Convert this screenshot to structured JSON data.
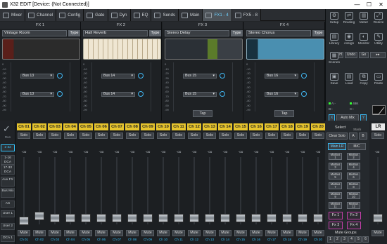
{
  "window": {
    "title": "X32 EDIT [Device: (Not Connected)]",
    "controls": [
      "—",
      "☐",
      "✕"
    ]
  },
  "nav": [
    {
      "label": "Mixer",
      "icon": "sliders-icon"
    },
    {
      "label": "Channel",
      "icon": "channel-icon"
    },
    {
      "label": "Config",
      "icon": "config-icon"
    },
    {
      "label": "Gate",
      "icon": "gate-icon"
    },
    {
      "label": "Dyn",
      "icon": "dyn-icon"
    },
    {
      "label": "EQ",
      "icon": "eq-icon"
    },
    {
      "label": "Sends",
      "icon": "sends-icon"
    },
    {
      "label": "Main",
      "icon": "main-icon"
    },
    {
      "label": "FX1 - 4",
      "icon": "fx-wave-icon",
      "active": true
    },
    {
      "label": "FX5 - 8",
      "icon": "fx-icon"
    }
  ],
  "fx": [
    {
      "header": "FX 1",
      "preset": "Vintage Room",
      "type": "Type",
      "buses": [
        "Bus 13",
        "Bus 13"
      ],
      "tap": ""
    },
    {
      "header": "FX 2",
      "preset": "Hall Reverb",
      "type": "Type",
      "buses": [
        "Bus 14",
        "Bus 14"
      ],
      "tap": ""
    },
    {
      "header": "FX 3",
      "preset": "Stereo Delay",
      "type": "Type",
      "buses": [
        "Bus 15",
        "Bus 15"
      ],
      "tap": "Tap"
    },
    {
      "header": "FX 4",
      "preset": "Stereo Chorus",
      "type": "Type",
      "buses": [
        "Bus 16",
        "Bus 16"
      ],
      "tap": "Tap"
    }
  ],
  "scale": [
    "0",
    "-10",
    "-20",
    "-30",
    "-40",
    "-50",
    "-60",
    "-70",
    "-80",
    "-90",
    "-99"
  ],
  "tools": [
    {
      "label": "Setup"
    },
    {
      "label": "Routing"
    },
    {
      "label": "Meter"
    },
    {
      "label": "Resize"
    },
    {
      "label": "Library"
    },
    {
      "label": "Assign"
    },
    {
      "label": "Monitor"
    },
    {
      "label": "Utility"
    },
    {
      "label": "Scenes"
    },
    {
      "label": "Save"
    },
    {
      "label": "Load"
    },
    {
      "label": "Copy"
    },
    {
      "label": "Paste"
    }
  ],
  "undo": {
    "h": "H",
    "undo": "Undo",
    "go": "Go"
  },
  "status": {
    "a": "A:-",
    "b": "B:-",
    "c": "C:-",
    "rate": "48K"
  },
  "automix": {
    "x": "X",
    "label": "Auto Mix",
    "y": "Y"
  },
  "lr": "LR",
  "select": {
    "label": "Select",
    "clear": "Clear Solo",
    "a": "A",
    "b": "B",
    "stack": "Stack",
    "mainlr": "Main LR",
    "mc": "M/C"
  },
  "groupbtns": [
    "MixBus 1",
    "MixBus 2",
    "MixBus 3",
    "MixBus 4",
    "MixBus 5",
    "MixBus 6",
    "MixBus 7",
    "MixBus 8",
    "MixBus 9",
    "MixBus 10",
    "MixBus 11",
    "MixBus 12"
  ],
  "fxbtns": [
    "Fx 1",
    "Fx 2",
    "Fx 3",
    "Fx 4"
  ],
  "mutegroups": {
    "label": "Mute Groups",
    "nums": [
      "1",
      "2",
      "3",
      "4",
      "5",
      "6"
    ]
  },
  "leftstrip": [
    "1-32",
    "1-16 DCA",
    "17-32 DCA",
    "Aux FX",
    "Bus Mix",
    "AS",
    "User 1",
    "User 2",
    "DCA 1"
  ],
  "channels": [
    "Ch 01",
    "Ch 02",
    "Ch 03",
    "Ch 04",
    "Ch 05",
    "Ch 06",
    "Ch 07",
    "Ch 08",
    "Ch 09",
    "Ch 10",
    "Ch 11",
    "Ch 12",
    "Ch 13",
    "Ch 14",
    "Ch 15",
    "Ch 16",
    "Ch 17",
    "Ch 18",
    "Ch 19",
    "Ch 20"
  ],
  "strip": {
    "solo": "Solo",
    "mute": "Mute",
    "value": "-oo"
  }
}
